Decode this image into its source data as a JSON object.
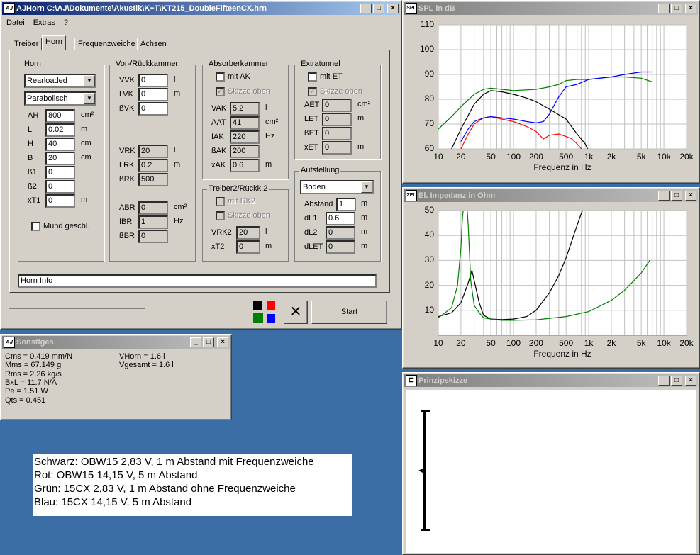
{
  "main_window": {
    "title": "AJHorn  C:\\AJ\\Dokumente\\Akustik\\K+T\\KT215_DoubleFifteenCX.hrn",
    "menu": [
      "Datei",
      "Extras",
      "?"
    ],
    "tabs": [
      "Treiber",
      "Horn",
      "Frequenzweiche",
      "Achsen"
    ],
    "selected_tab": "Horn",
    "horn": {
      "group": "Horn",
      "type": "Rearloaded",
      "profile": "Parabolisch",
      "fields": [
        {
          "label": "AH",
          "value": "800",
          "unit": "cm²"
        },
        {
          "label": "L",
          "value": "0.02",
          "unit": "m"
        },
        {
          "label": "H",
          "value": "40",
          "unit": "cm"
        },
        {
          "label": "B",
          "value": "20",
          "unit": "cm"
        },
        {
          "label": "ß1",
          "value": "0",
          "unit": ""
        },
        {
          "label": "ß2",
          "value": "0",
          "unit": ""
        },
        {
          "label": "xT1",
          "value": "0",
          "unit": "m"
        }
      ],
      "mund_label": "Mund geschl."
    },
    "vor": {
      "group": "Vor-/Rückkammer",
      "fields": [
        {
          "label": "VVK",
          "value": "0",
          "unit": "l"
        },
        {
          "label": "LVK",
          "value": "0",
          "unit": "m"
        },
        {
          "label": "ßVK",
          "value": "0",
          "unit": ""
        }
      ],
      "rk_fields": [
        {
          "label": "VRK",
          "value": "20",
          "unit": "l"
        },
        {
          "label": "LRK",
          "value": "0.2",
          "unit": "m"
        },
        {
          "label": "ßRK",
          "value": "500",
          "unit": ""
        }
      ],
      "br_fields": [
        {
          "label": "ABR",
          "value": "0",
          "unit": "cm²"
        },
        {
          "label": "fBR",
          "value": "1",
          "unit": "Hz"
        },
        {
          "label": "ßBR",
          "value": "0",
          "unit": ""
        }
      ]
    },
    "absorber": {
      "group": "Absorberkammer",
      "mit_label": "mit AK",
      "skizze_label": "Skizze oben",
      "fields": [
        {
          "label": "VAK",
          "value": "5.2",
          "unit": "l"
        },
        {
          "label": "AAT",
          "value": "41",
          "unit": "cm²"
        },
        {
          "label": "fAK",
          "value": "220",
          "unit": "Hz"
        },
        {
          "label": "ßAK",
          "value": "200",
          "unit": ""
        },
        {
          "label": "xAK",
          "value": "0.6",
          "unit": "m"
        }
      ]
    },
    "treiber2": {
      "group": "Treiber2/Rückk.2",
      "mit_label": "mit RK2",
      "skizze_label": "Skizze oben",
      "fields": [
        {
          "label": "VRK2",
          "value": "20",
          "unit": "l"
        },
        {
          "label": "xT2",
          "value": "0",
          "unit": "m"
        }
      ]
    },
    "extratunnel": {
      "group": "Extratunnel",
      "mit_label": "mit ET",
      "skizze_label": "Skizze oben",
      "fields": [
        {
          "label": "AET",
          "value": "0",
          "unit": "cm²"
        },
        {
          "label": "LET",
          "value": "0",
          "unit": "m"
        },
        {
          "label": "ßET",
          "value": "0",
          "unit": ""
        },
        {
          "label": "xET",
          "value": "0",
          "unit": "m"
        }
      ]
    },
    "aufstellung": {
      "group": "Aufstellung",
      "mode": "Boden",
      "fields": [
        {
          "label": "Abstand",
          "value": "1",
          "unit": "m"
        },
        {
          "label": "dL1",
          "value": "0.6",
          "unit": "m"
        },
        {
          "label": "dL2",
          "value": "0",
          "unit": "m"
        },
        {
          "label": "dLET",
          "value": "0",
          "unit": "m"
        }
      ]
    },
    "horn_info": "Horn Info",
    "start_label": "Start",
    "close_glyph": "✕",
    "color_swatches": [
      "#000000",
      "#ff0000",
      "#008000",
      "#0000ff"
    ]
  },
  "sonstiges": {
    "title": "Sonstiges",
    "left": [
      "Cms = 0.419 mm/N",
      "Mms = 67.149 g",
      "Rms = 2.26 kg/s",
      "BxL = 11.7 N/A",
      "Pe = 1.51 W",
      "Qts = 0.451"
    ],
    "right": [
      "VHorn = 1.6 l",
      "Vgesamt = 1.6 l"
    ]
  },
  "notes": [
    "Schwarz: OBW15 2,83 V, 1 m Abstand mit Frequenzweiche",
    "Rot: OBW15 14,15 V, 5 m Abstand",
    "Grün: 15CX 2,83 V, 1 m Abstand ohne Frequenzweiche",
    "Blau: 15CX 14,15 V, 5 m Abstand"
  ],
  "spl_window": {
    "title": "SPL in dB",
    "icon": "SPL"
  },
  "imp_window": {
    "title": "El. Impedanz in Ohm",
    "icon": "ZEL"
  },
  "skizze_window": {
    "title": "Prinzipskizze"
  },
  "chart_data": [
    {
      "type": "line",
      "title": "SPL in dB",
      "xlabel": "Frequenz in Hz",
      "ylabel": "",
      "xscale": "log",
      "xlim": [
        10,
        20000
      ],
      "ylim": [
        60,
        110
      ],
      "x_ticks": [
        10,
        20,
        50,
        100,
        200,
        500,
        1000,
        2000,
        5000,
        10000,
        20000
      ],
      "x_tick_labels": [
        "10",
        "20",
        "50",
        "100",
        "200",
        "500",
        "1k",
        "2k",
        "5k",
        "10k",
        "20k"
      ],
      "y_ticks": [
        60,
        70,
        80,
        90,
        100,
        110
      ],
      "y_tick_labels": [
        "60",
        "70",
        "80",
        "90",
        "100",
        "110"
      ],
      "grid": true,
      "series": [
        {
          "color": "#000000",
          "x": [
            15,
            20,
            30,
            40,
            50,
            70,
            100,
            150,
            200,
            300,
            500,
            700,
            900,
            1000
          ],
          "y": [
            60,
            68,
            78,
            82,
            83.5,
            83,
            82,
            80.5,
            79,
            76,
            72,
            66,
            62,
            59
          ]
        },
        {
          "color": "#ff0000",
          "x": [
            20,
            25,
            30,
            40,
            50,
            70,
            100,
            150,
            200,
            250,
            300,
            400,
            500,
            600,
            700,
            800
          ],
          "y": [
            60,
            66,
            70,
            72.5,
            73,
            72,
            71,
            69,
            67,
            64,
            65.5,
            66,
            65,
            64,
            62,
            60
          ]
        },
        {
          "color": "#008000",
          "x": [
            10,
            15,
            20,
            30,
            40,
            50,
            70,
            100,
            200,
            300,
            400,
            500,
            700,
            1000,
            2000,
            3000,
            5000,
            7000
          ],
          "y": [
            68,
            73,
            77,
            82,
            84,
            84.5,
            84,
            83.5,
            84,
            85,
            86,
            87.5,
            88,
            88,
            89,
            89,
            88.5,
            87
          ]
        },
        {
          "color": "#0000ff",
          "x": [
            20,
            25,
            30,
            40,
            50,
            70,
            100,
            150,
            200,
            250,
            300,
            400,
            500,
            700,
            1000,
            2000,
            3000,
            5000,
            7000
          ],
          "y": [
            63,
            68,
            71,
            72.5,
            73,
            72.5,
            72,
            71,
            70.5,
            71,
            74,
            81,
            85,
            86,
            88,
            89,
            90,
            91,
            91
          ]
        }
      ]
    },
    {
      "type": "line",
      "title": "El. Impedanz in Ohm",
      "xlabel": "Frequenz in Hz",
      "ylabel": "",
      "xscale": "log",
      "xlim": [
        10,
        20000
      ],
      "ylim": [
        0,
        50
      ],
      "x_ticks": [
        10,
        20,
        50,
        100,
        200,
        500,
        1000,
        2000,
        5000,
        10000,
        20000
      ],
      "x_tick_labels": [
        "10",
        "20",
        "50",
        "100",
        "200",
        "500",
        "1k",
        "2k",
        "5k",
        "10k",
        "20k"
      ],
      "y_ticks": [
        10,
        20,
        30,
        40,
        50
      ],
      "y_tick_labels": [
        "10",
        "20",
        "30",
        "40",
        "50"
      ],
      "grid": true,
      "series": [
        {
          "color": "#000000",
          "x": [
            10,
            15,
            20,
            25,
            28,
            30,
            35,
            40,
            50,
            70,
            100,
            150,
            200,
            300,
            400,
            500,
            600,
            700,
            800,
            900
          ],
          "y": [
            7.5,
            9,
            13,
            21,
            26,
            22,
            13,
            8,
            6.5,
            6.3,
            6.5,
            7.5,
            10,
            17,
            24,
            31,
            38,
            44,
            49,
            52
          ]
        },
        {
          "color": "#008000",
          "x": [
            10,
            15,
            18,
            20,
            21,
            22,
            23,
            24,
            25,
            27,
            30,
            35,
            40,
            50,
            70,
            100,
            200,
            500,
            1000,
            2000,
            3000,
            5000,
            6500
          ],
          "y": [
            7,
            11,
            20,
            35,
            48,
            52,
            52,
            52,
            44,
            22,
            12,
            9,
            7,
            6.5,
            6,
            6,
            6.2,
            7.5,
            9.5,
            14,
            18,
            25,
            30
          ]
        }
      ]
    }
  ]
}
